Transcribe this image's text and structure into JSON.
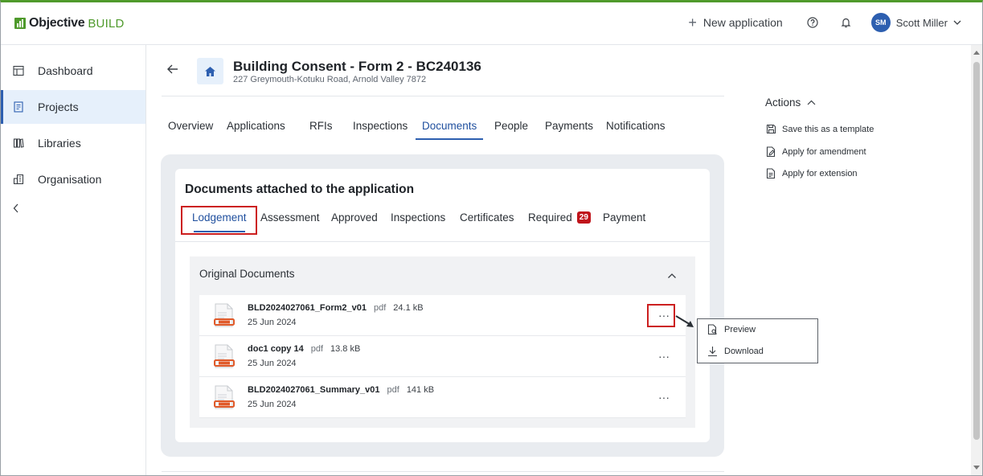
{
  "brand": {
    "name_bold": "Objective",
    "name_light": "BUILD",
    "accent": "#4f9a2c"
  },
  "header": {
    "new_application_label": "New application",
    "help_icon": "question-circle-icon",
    "notifications_icon": "bell-icon",
    "user_initials": "SM",
    "user_name": "Scott Miller"
  },
  "sidebar": {
    "items": [
      {
        "label": "Dashboard",
        "icon": "dashboard-icon",
        "active": false
      },
      {
        "label": "Projects",
        "icon": "projects-icon",
        "active": true
      },
      {
        "label": "Libraries",
        "icon": "libraries-icon",
        "active": false
      },
      {
        "label": "Organisation",
        "icon": "organisation-icon",
        "active": false
      }
    ],
    "collapse_icon": "chevron-left-icon"
  },
  "application": {
    "title": "Building Consent - Form 2 - BC240136",
    "address": "227 Greymouth-Kotuku Road, Arnold Valley 7872"
  },
  "tabs": [
    "Overview",
    "Applications",
    "RFIs",
    "Inspections",
    "Documents",
    "People",
    "Payments",
    "Notifications"
  ],
  "active_tab": "Documents",
  "documents_panel": {
    "title": "Documents attached to the application",
    "subtabs": [
      "Lodgement",
      "Assessment",
      "Approved",
      "Inspections",
      "Certificates",
      "Required",
      "Payment"
    ],
    "active_subtab": "Lodgement",
    "required_count": "29",
    "section_title": "Original Documents",
    "documents": [
      {
        "name": "BLD2024027061_Form2_v01",
        "type": "pdf",
        "size": "24.1 kB",
        "date": "25 Jun 2024"
      },
      {
        "name": "doc1 copy 14",
        "type": "pdf",
        "size": "13.8 kB",
        "date": "25 Jun 2024"
      },
      {
        "name": "BLD2024027061_Summary_v01",
        "type": "pdf",
        "size": "141 kB",
        "date": "25 Jun 2024"
      }
    ],
    "more_label": "···"
  },
  "context_menu": {
    "items": [
      {
        "label": "Preview",
        "icon": "preview-icon"
      },
      {
        "label": "Download",
        "icon": "download-icon"
      }
    ]
  },
  "actions": {
    "title": "Actions",
    "items": [
      {
        "label": "Save this as a template",
        "icon": "save-icon"
      },
      {
        "label": "Apply for amendment",
        "icon": "edit-document-icon"
      },
      {
        "label": "Apply for extension",
        "icon": "document-icon"
      }
    ]
  },
  "colors": {
    "primary": "#2d5fb0",
    "highlight": "#cc1f1f",
    "badge": "#c0141b"
  }
}
